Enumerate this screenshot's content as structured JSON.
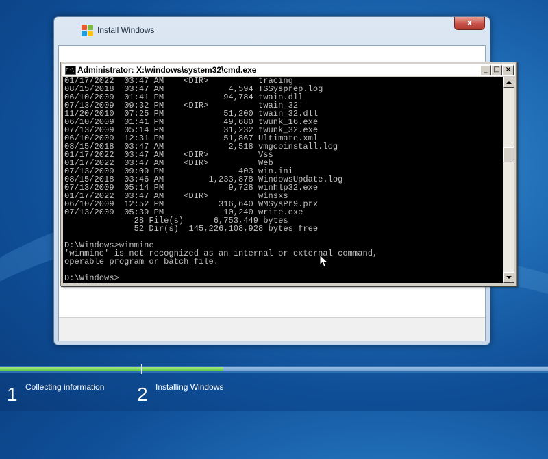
{
  "setup": {
    "title": "Install Windows",
    "close_label": "x"
  },
  "cmd": {
    "title": "Administrator: X:\\windows\\system32\\cmd.exe",
    "lines": [
      "01/17/2022  03:47 AM    <DIR>          tracing",
      "08/15/2018  03:47 AM             4,594 TSSysprep.log",
      "06/10/2009  01:41 PM            94,784 twain.dll",
      "07/13/2009  09:32 PM    <DIR>          twain_32",
      "11/20/2010  07:25 PM            51,200 twain_32.dll",
      "06/10/2009  01:41 PM            49,680 twunk_16.exe",
      "07/13/2009  05:14 PM            31,232 twunk_32.exe",
      "06/10/2009  12:31 PM            51,867 Ultimate.xml",
      "08/15/2018  03:47 AM             2,518 vmgcoinstall.log",
      "01/17/2022  03:47 AM    <DIR>          Vss",
      "01/17/2022  03:47 AM    <DIR>          Web",
      "07/13/2009  09:09 PM               403 win.ini",
      "08/15/2018  03:46 AM         1,233,878 WindowsUpdate.log",
      "07/13/2009  05:14 PM             9,728 winhlp32.exe",
      "01/17/2022  03:47 AM    <DIR>          winsxs",
      "06/10/2009  12:52 PM           316,640 WMSysPr9.prx",
      "07/13/2009  05:39 PM            10,240 write.exe",
      "              28 File(s)      6,753,449 bytes",
      "              52 Dir(s)  145,226,108,928 bytes free",
      "",
      "D:\\Windows>winmine",
      "'winmine' is not recognized as an internal or external command,",
      "operable program or batch file.",
      "",
      "D:\\Windows>"
    ]
  },
  "steps": [
    {
      "number": "1",
      "label": "Collecting information"
    },
    {
      "number": "2",
      "label": "Installing Windows"
    }
  ],
  "progress": {
    "step1_fraction": 1.0,
    "step2_fraction": 0.2
  },
  "colors": {
    "progress_fill": "#55c237",
    "console_bg": "#000000",
    "console_text": "#c0c0c0"
  }
}
